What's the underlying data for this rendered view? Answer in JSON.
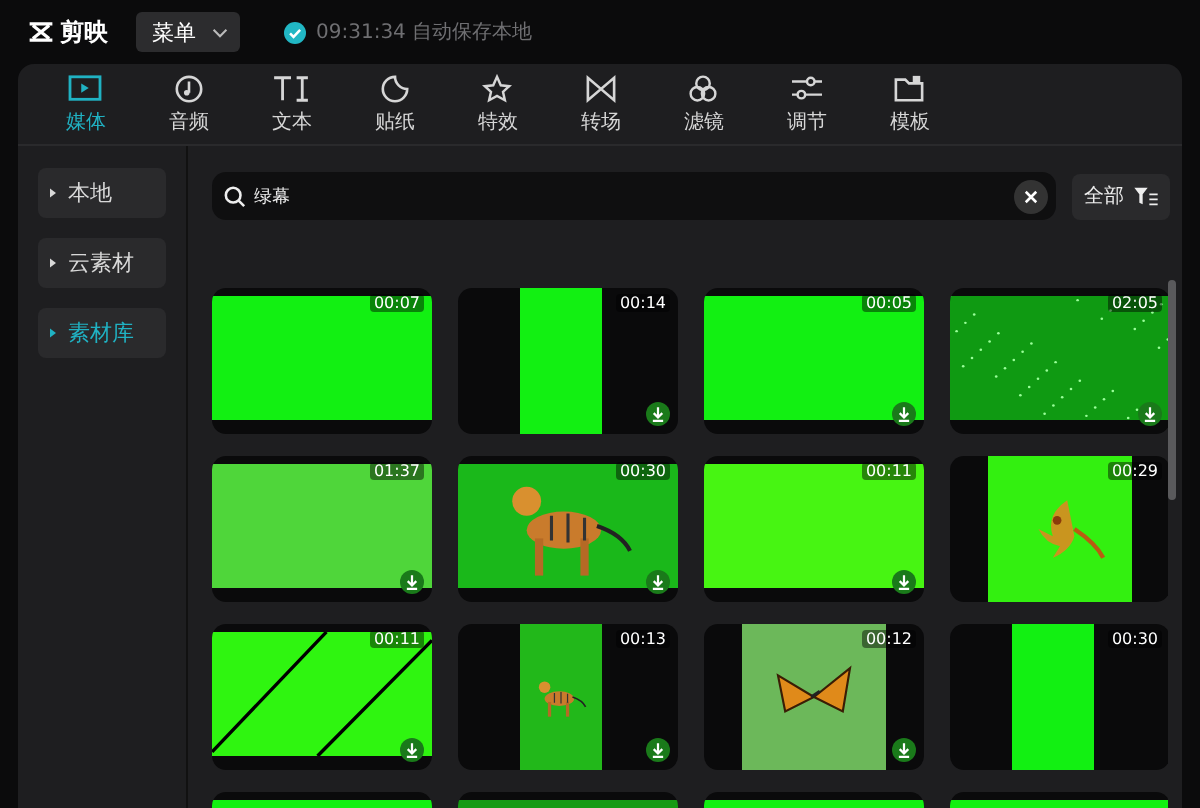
{
  "app": {
    "name": "剪映",
    "menu": "菜单",
    "save_status": "09:31:34 自动保存本地"
  },
  "tabs": [
    {
      "label": "媒体",
      "selected": true
    },
    {
      "label": "音频",
      "selected": false
    },
    {
      "label": "文本",
      "selected": false
    },
    {
      "label": "贴纸",
      "selected": false
    },
    {
      "label": "特效",
      "selected": false
    },
    {
      "label": "转场",
      "selected": false
    },
    {
      "label": "滤镜",
      "selected": false
    },
    {
      "label": "调节",
      "selected": false
    },
    {
      "label": "模板",
      "selected": false
    }
  ],
  "sidebar": {
    "items": [
      {
        "label": "本地",
        "selected": false
      },
      {
        "label": "云素材",
        "selected": false
      },
      {
        "label": "素材库",
        "selected": true
      }
    ]
  },
  "search": {
    "value": "绿幕",
    "filter": "全部"
  },
  "clips": [
    {
      "duration": "00:07",
      "kind": "wide",
      "picture": false,
      "color": "#12f012",
      "download": false
    },
    {
      "duration": "00:14",
      "kind": "narrow",
      "picture": false,
      "color": "#12f012",
      "download": true
    },
    {
      "duration": "00:05",
      "kind": "wide",
      "picture": false,
      "color": "#12f012",
      "download": true
    },
    {
      "duration": "02:05",
      "kind": "speckled",
      "picture": false,
      "color": "#0f9a12",
      "download": true
    },
    {
      "duration": "01:37",
      "kind": "wide",
      "picture": false,
      "color": "#4fd63a",
      "download": true
    },
    {
      "duration": "00:30",
      "kind": "wide",
      "picture": true,
      "color": "#1ab81a",
      "download": true
    },
    {
      "duration": "00:11",
      "kind": "wide",
      "picture": false,
      "color": "#47f512",
      "download": true
    },
    {
      "duration": "00:29",
      "kind": "square",
      "picture": true,
      "color": "#33f010",
      "download": false
    },
    {
      "duration": "00:11",
      "kind": "striped",
      "picture": false,
      "color": "#2ff510",
      "download": true
    },
    {
      "duration": "00:13",
      "kind": "narrow",
      "picture": true,
      "color": "#22b81a",
      "download": true
    },
    {
      "duration": "00:12",
      "kind": "square",
      "picture": true,
      "color": "#6cb85a",
      "download": true
    },
    {
      "duration": "00:30",
      "kind": "narrow",
      "picture": false,
      "color": "#12f012",
      "download": false
    },
    {
      "kind": "wide",
      "color": "#12f012"
    },
    {
      "kind": "wide",
      "color": "#169a14"
    },
    {
      "kind": "wide",
      "color": "#12f012"
    },
    {
      "kind": "wide",
      "color": "#12f012"
    }
  ]
}
